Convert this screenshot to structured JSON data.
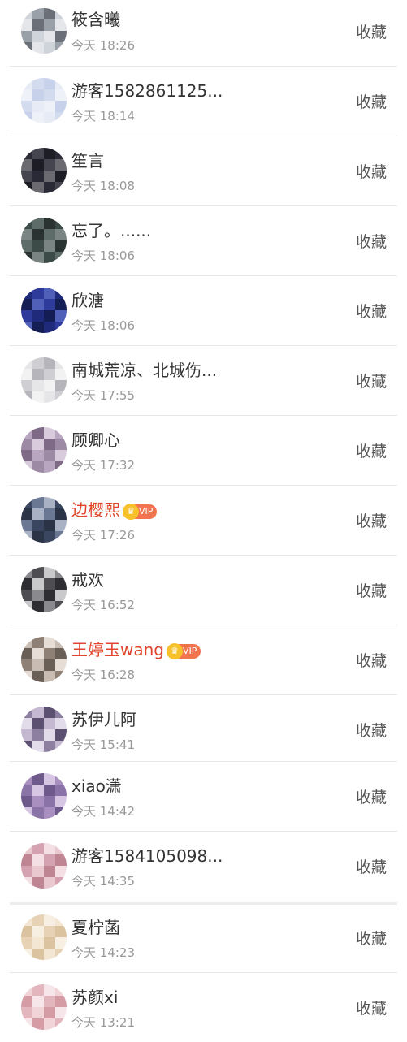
{
  "fav_label": "收藏",
  "rows": [
    {
      "name": "筱含曦",
      "time": "今天 18:26",
      "vip": false,
      "colors": [
        "#cfd3da",
        "#9aa0a8",
        "#6b7078",
        "#e4e6ea"
      ]
    },
    {
      "name": "游客1582861125...",
      "time": "今天 18:14",
      "vip": false,
      "colors": [
        "#e6ebf6",
        "#d3dbef",
        "#c7d1ea",
        "#eef1f8"
      ]
    },
    {
      "name": "笙言",
      "time": "今天 18:08",
      "vip": false,
      "colors": [
        "#2a2a36",
        "#45454f",
        "#1d1d25",
        "#6a6a70"
      ]
    },
    {
      "name": "忘了。......",
      "time": "今天 18:06",
      "vip": false,
      "colors": [
        "#3c4a48",
        "#5d6b69",
        "#2a3332",
        "#7a8482"
      ]
    },
    {
      "name": "欣溏",
      "time": "今天 18:06",
      "vip": false,
      "colors": [
        "#1f2a7a",
        "#2f3b9a",
        "#5060b8",
        "#151d55"
      ]
    },
    {
      "name": "南城荒凉、北城伤...",
      "time": "今天 17:55",
      "vip": false,
      "colors": [
        "#e6e6e8",
        "#cfcfd3",
        "#b5b5bb",
        "#f2f2f3"
      ]
    },
    {
      "name": "顾卿心",
      "time": "今天 17:32",
      "vip": false,
      "colors": [
        "#b8a5bf",
        "#7e6a86",
        "#d8cbdc",
        "#9c89a4"
      ]
    },
    {
      "name": "边樱熙",
      "time": "今天 17:26",
      "vip": true,
      "vip_text": "VIP",
      "colors": [
        "#3a4660",
        "#6b7893",
        "#a9b2c4",
        "#2b3346"
      ]
    },
    {
      "name": "戒欢",
      "time": "今天 16:52",
      "vip": false,
      "colors": [
        "#8a8a8e",
        "#4d4d52",
        "#c9c9cc",
        "#2e2e32"
      ]
    },
    {
      "name": "王婷玉wang",
      "time": "今天 16:28",
      "vip": true,
      "vip_text": "VIP",
      "colors": [
        "#c9bdb3",
        "#8e8075",
        "#e5ddd6",
        "#6a5f57"
      ]
    },
    {
      "name": "苏伊儿阿",
      "time": "今天 15:41",
      "vip": false,
      "colors": [
        "#8c7fa0",
        "#c4b9d1",
        "#5d5172",
        "#e2dbe9"
      ]
    },
    {
      "name": "xiao潇",
      "time": "今天 14:42",
      "vip": false,
      "colors": [
        "#a98fc0",
        "#6f5a8c",
        "#d6c6e3",
        "#8a73a6"
      ]
    },
    {
      "name": "游客1584105098...",
      "time": "今天 14:35",
      "vip": false,
      "colors": [
        "#eac8cf",
        "#d4a2b0",
        "#f3dfe4",
        "#c08593"
      ]
    },
    {
      "name": "夏柠菡",
      "time": "今天 14:23",
      "vip": false,
      "colors": [
        "#f3e6d3",
        "#e7d2b6",
        "#f8efe3",
        "#dcc39f"
      ]
    },
    {
      "name": "苏颜xi",
      "time": "今天 13:21",
      "vip": false,
      "colors": [
        "#f0d4d8",
        "#e3b5bc",
        "#f7e6e9",
        "#d69ca6"
      ]
    }
  ]
}
